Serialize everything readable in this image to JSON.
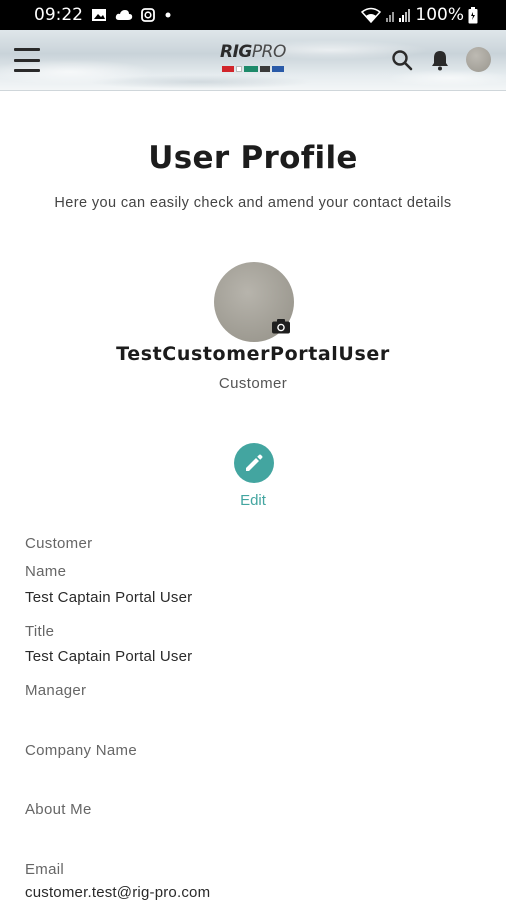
{
  "status_bar": {
    "time": "09:22",
    "battery": "100%",
    "icons": [
      "gallery-icon",
      "cloud-icon",
      "instagram-icon",
      "dot-icon",
      "wifi-icon",
      "signal-icon",
      "battery-icon"
    ]
  },
  "header": {
    "logo_rig": "RIG",
    "logo_pro": "PRO",
    "logo_stripe_colors": [
      "#d1252b",
      "#ffffff",
      "#1e8a6a",
      "#3a3a3a",
      "#2a5aa8"
    ],
    "icons": [
      "menu-icon",
      "search-icon",
      "bell-icon",
      "avatar"
    ]
  },
  "page": {
    "title": "User Profile",
    "subtitle": "Here you can easily check and amend your contact details"
  },
  "profile": {
    "name": "TestCustomerPortalUser",
    "role": "Customer",
    "edit_label": "Edit"
  },
  "details": {
    "section_heading": "Customer",
    "fields": [
      {
        "label": "Name",
        "value": "Test Captain Portal User"
      },
      {
        "label": "Title",
        "value": "Test Captain Portal User"
      },
      {
        "label": "Manager",
        "value": ""
      },
      {
        "label": "Company Name",
        "value": ""
      },
      {
        "label": "About Me",
        "value": ""
      },
      {
        "label": "Email",
        "value": "customer.test@rig-pro.com"
      }
    ]
  },
  "colors": {
    "accent": "#43a5a0",
    "title": "#1c1c1c",
    "label": "#666666"
  }
}
